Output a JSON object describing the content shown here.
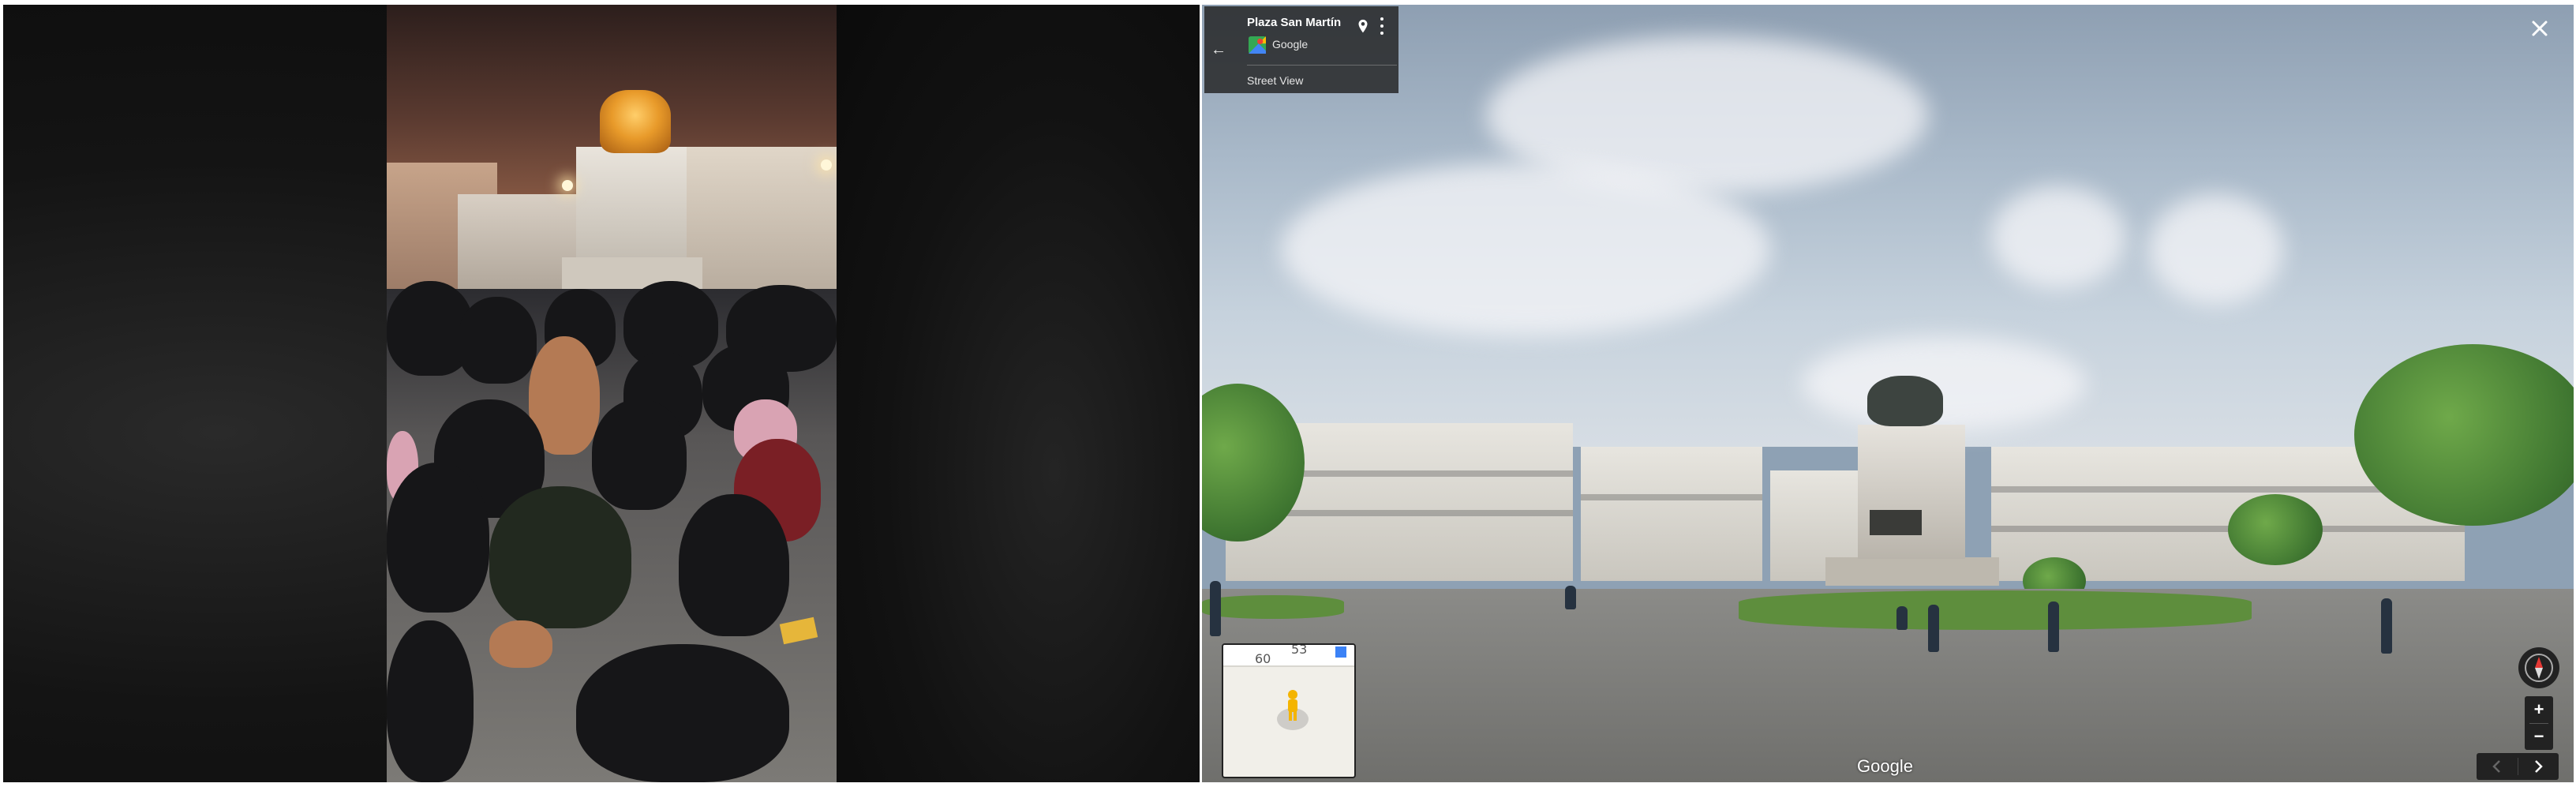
{
  "street_view": {
    "place_title": "Plaza San Martín",
    "provider_label": "Google",
    "mode_label": "Street View",
    "watermark": "Google",
    "zoom_in_label": "+",
    "zoom_out_label": "−",
    "back_label": "←"
  },
  "mini_map": {
    "road_labels": [
      "60",
      "53"
    ]
  },
  "icons": {
    "back": "arrow-left-icon",
    "pin": "map-pin-icon",
    "more": "more-vert-icon",
    "close": "close-icon",
    "compass": "compass-icon",
    "pegman": "pegman-icon",
    "prev": "chevron-left-icon",
    "next": "chevron-right-icon"
  },
  "colors": {
    "overlay": "#222222",
    "card_text": "#ffffff",
    "map_bg": "#f1efe9",
    "compass_needle": "#e53935",
    "pegman": "#f4b400"
  }
}
